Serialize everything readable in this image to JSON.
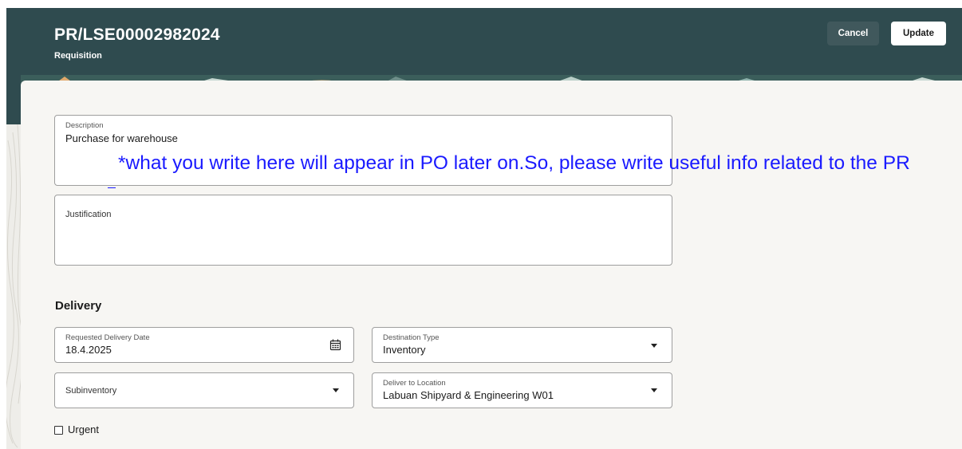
{
  "header": {
    "title": "PR/LSE00002982024",
    "subtitle": "Requisition",
    "cancel_label": "Cancel",
    "update_label": "Update"
  },
  "form": {
    "description": {
      "label": "Description",
      "value": "Purchase for warehouse"
    },
    "justification": {
      "label": "Justification",
      "value": ""
    }
  },
  "annotation": {
    "text": "*what you write here will appear in PO later on.So, please write useful info related to the PR"
  },
  "delivery": {
    "title": "Delivery",
    "requested_date": {
      "label": "Requested Delivery Date",
      "value": "18.4.2025",
      "icon": "calendar-icon"
    },
    "destination_type": {
      "label": "Destination Type",
      "value": "Inventory"
    },
    "subinventory": {
      "label": "Subinventory",
      "value": ""
    },
    "deliver_to_location": {
      "label": "Deliver to Location",
      "value": "Labuan Shipyard & Engineering W01"
    },
    "urgent": {
      "label": "Urgent",
      "checked": false
    }
  },
  "colors": {
    "header_bg": "#2f4b4f",
    "panel_bg": "#f7f6f3",
    "annotation": "#1a1aff"
  }
}
